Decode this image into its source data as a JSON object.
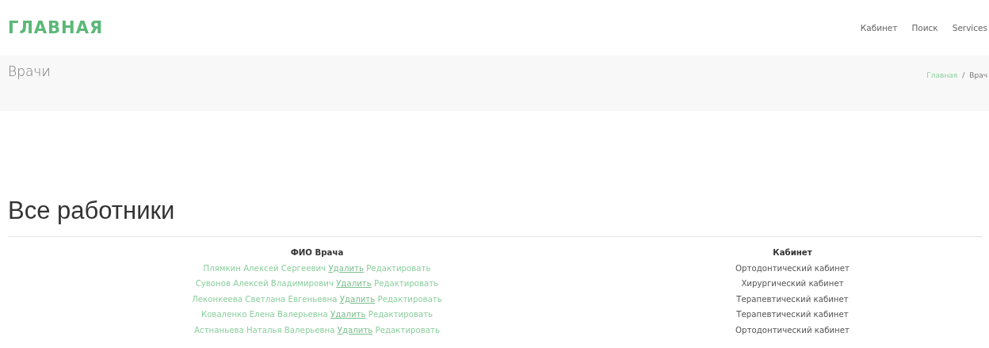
{
  "header": {
    "logo": "ГЛАВНАЯ",
    "nav": [
      "Кабинет",
      "Поиск",
      "Services"
    ]
  },
  "page_title": {
    "title": "Врачи",
    "breadcrumb": [
      "Главная",
      "Врач"
    ],
    "breadcrumb_separator": "/"
  },
  "section": {
    "title": "Все работники"
  },
  "table": {
    "columns": [
      "ФИО Врача",
      "Кабинет"
    ],
    "rows": [
      {
        "name": "Плямкин Алексей Сергеевич",
        "delete": "Удалить",
        "edit": "Редактировать",
        "cabinet": "Ортодонтический кабинет"
      },
      {
        "name": "Сувонов Алексей Владимирович",
        "delete": "Удалить",
        "edit": "Редактировать",
        "cabinet": "Хирургический кабинет"
      },
      {
        "name": "Леконкеева Светлана Евгеньевна",
        "delete": "Удалить",
        "edit": "Редактировать",
        "cabinet": "Терапевтический кабинет"
      },
      {
        "name": "Коваленко Елена Валерьевна",
        "delete": "Удалить",
        "edit": "Редактировать",
        "cabinet": "Терапевтический кабинет"
      },
      {
        "name": "Астнаньева Наталья Валерьевна",
        "delete": "Удалить",
        "edit": "Редактировать",
        "cabinet": "Ортодонтический кабинет"
      }
    ]
  }
}
